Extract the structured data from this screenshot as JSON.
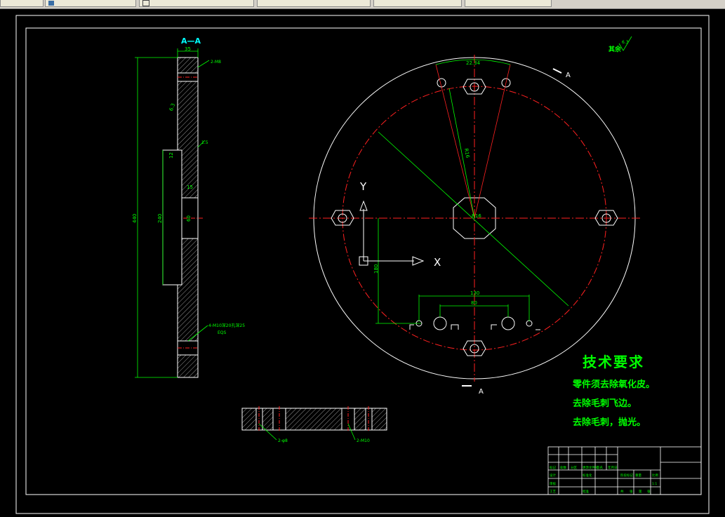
{
  "window": {
    "tabs": [
      {
        "label": ""
      },
      {
        "label": "",
        "icon": "document-icon"
      },
      {
        "label": "",
        "icon": "document-icon"
      },
      {
        "label": ""
      },
      {
        "label": ""
      },
      {
        "label": ""
      }
    ]
  },
  "drawing": {
    "section_label": "A—A",
    "view_marker_top": "A",
    "view_marker_bottom": "A",
    "roughness_note": "其余",
    "roughness_value": "6.3",
    "roughness_side": "6.3",
    "axis_x": "X",
    "axis_y": "Y",
    "dims": {
      "width": "35",
      "overall_height": "440",
      "recess_height": "240",
      "hole_dia": "60",
      "chamfer": "1.5",
      "recess_depth": "12",
      "step": "15",
      "angle": "22.34",
      "radius": "R16",
      "center_dia": "R16",
      "offset": "180",
      "span_outer": "130",
      "span_inner": "80",
      "thread_top": "2-M8",
      "thread_side": "4-M10深20孔深25",
      "thread_side2": "EQS",
      "sec_left": "2-φ8",
      "sec_right": "2-M10"
    }
  },
  "technical_requirements": {
    "title": "技术要求",
    "items": [
      "零件须去除氧化皮。",
      "去除毛刺飞边。",
      "去除毛刺，抛光。"
    ]
  },
  "title_block": {
    "cells": [
      "标记",
      "处数",
      "分区",
      "更改文件号",
      "签名",
      "年月日",
      "设计",
      "标准化",
      "阶段标记",
      "重量",
      "比例",
      "审核",
      "工艺",
      "批准",
      "共",
      "张",
      "第",
      "张",
      "1:1"
    ]
  },
  "colors": {
    "background": "#000000",
    "outline": "#ffffff",
    "centerline": "#ff2020",
    "dimension": "#00ff00",
    "label": "#00ffff"
  }
}
